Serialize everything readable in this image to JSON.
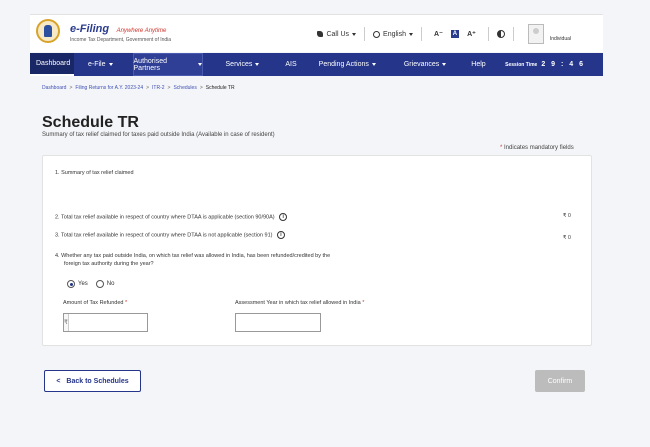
{
  "header": {
    "logo_main": "e-Filing",
    "logo_tagline": "Anywhere Anytime",
    "logo_sub": "Income Tax Department, Government of India",
    "call_us": "Call Us",
    "language": "English",
    "font_small": "A⁻",
    "font_normal": "A",
    "font_large": "A⁺",
    "user_type": "Individual"
  },
  "nav": {
    "items": [
      "Dashboard",
      "e-File",
      "Authorised Partners",
      "Services",
      "AIS",
      "Pending Actions",
      "Grievances",
      "Help"
    ],
    "session_label": "Session Time",
    "session_value": "2 9 : 4 6"
  },
  "breadcrumb": [
    "Dashboard",
    "Filing Returns for A.Y. 2023-24",
    "ITR-2",
    "Schedules",
    "Schedule TR"
  ],
  "page": {
    "title": "Schedule TR",
    "subtitle": "Summary of tax relief claimed for taxes paid outside India (Available in case of resident)",
    "mandatory_note": "Indicates mandatory fields",
    "asterisk": "*"
  },
  "form": {
    "q1": "1. Summary of tax relief claimed",
    "q2": "2. Total tax relief available in respect of country where DTAA is applicable (section 90/90A)",
    "q2_amount": "₹ 0",
    "q3": "3. Total tax relief available in respect of country where DTAA is not applicable (section 91)",
    "q3_amount": "₹ 0",
    "q4_line1": "4. Whether any tax paid outside India, on which tax relief was allowed in India, has been refunded/credited by the",
    "q4_line2": "foreign tax authority during the year?",
    "opt_yes": "Yes",
    "opt_no": "No",
    "selected": "Yes",
    "amount_label": "Amount of Tax Refunded",
    "amount_value": "",
    "rupee": "₹",
    "ay_label": "Assessment Year in which tax relief allowed in India",
    "ay_value": "",
    "info": "i"
  },
  "actions": {
    "back": "Back to Schedules",
    "back_chevron": "<",
    "confirm": "Confirm"
  }
}
